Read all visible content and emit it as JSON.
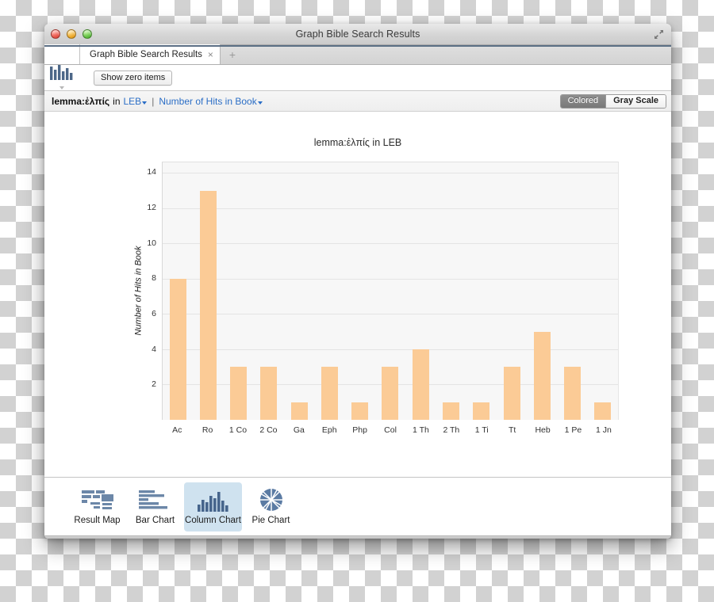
{
  "window": {
    "title": "Graph Bible Search Results",
    "controls": [
      "close",
      "minimize",
      "zoom"
    ],
    "expand_icon": "expand-arrows-icon"
  },
  "tabs": {
    "items": [
      {
        "label": "Graph Bible Search Results",
        "close": "×",
        "active": true
      }
    ],
    "new_tab_label": "+"
  },
  "toolbar": {
    "app_icon": "column-chart-icon",
    "show_zero_label": "Show zero items"
  },
  "breadcrumb": {
    "query": "lemma:ἐλπίς",
    "in_word": "in",
    "resource": "LEB",
    "separator": "|",
    "measure": "Number of Hits in Book"
  },
  "color_toggle": {
    "options": [
      "Colored",
      "Gray Scale"
    ],
    "selected": "Colored"
  },
  "chart_data": {
    "type": "bar",
    "title": "lemma:ἐλπίς in LEB",
    "xlabel": "",
    "ylabel": "Number of Hits in Book",
    "categories": [
      "Ac",
      "Ro",
      "1 Co",
      "2 Co",
      "Ga",
      "Eph",
      "Php",
      "Col",
      "1 Th",
      "2 Th",
      "1 Ti",
      "Tt",
      "Heb",
      "1 Pe",
      "1 Jn"
    ],
    "values": [
      8,
      13,
      3,
      3,
      1,
      3,
      1,
      3,
      4,
      1,
      1,
      3,
      5,
      3,
      1
    ],
    "yticks": [
      2,
      4,
      6,
      8,
      10,
      12,
      14
    ],
    "ylim": [
      0,
      14.6
    ],
    "grid": true,
    "legend": false,
    "bar_color": "#fbcb96",
    "plot_background": "#f7f7f7"
  },
  "view_modes": {
    "items": [
      {
        "label": "Result Map",
        "icon": "result-map-icon",
        "selected": false
      },
      {
        "label": "Bar Chart",
        "icon": "bar-chart-icon",
        "selected": false
      },
      {
        "label": "Column Chart",
        "icon": "column-chart-icon",
        "selected": true
      },
      {
        "label": "Pie Chart",
        "icon": "pie-chart-icon",
        "selected": false
      }
    ]
  }
}
